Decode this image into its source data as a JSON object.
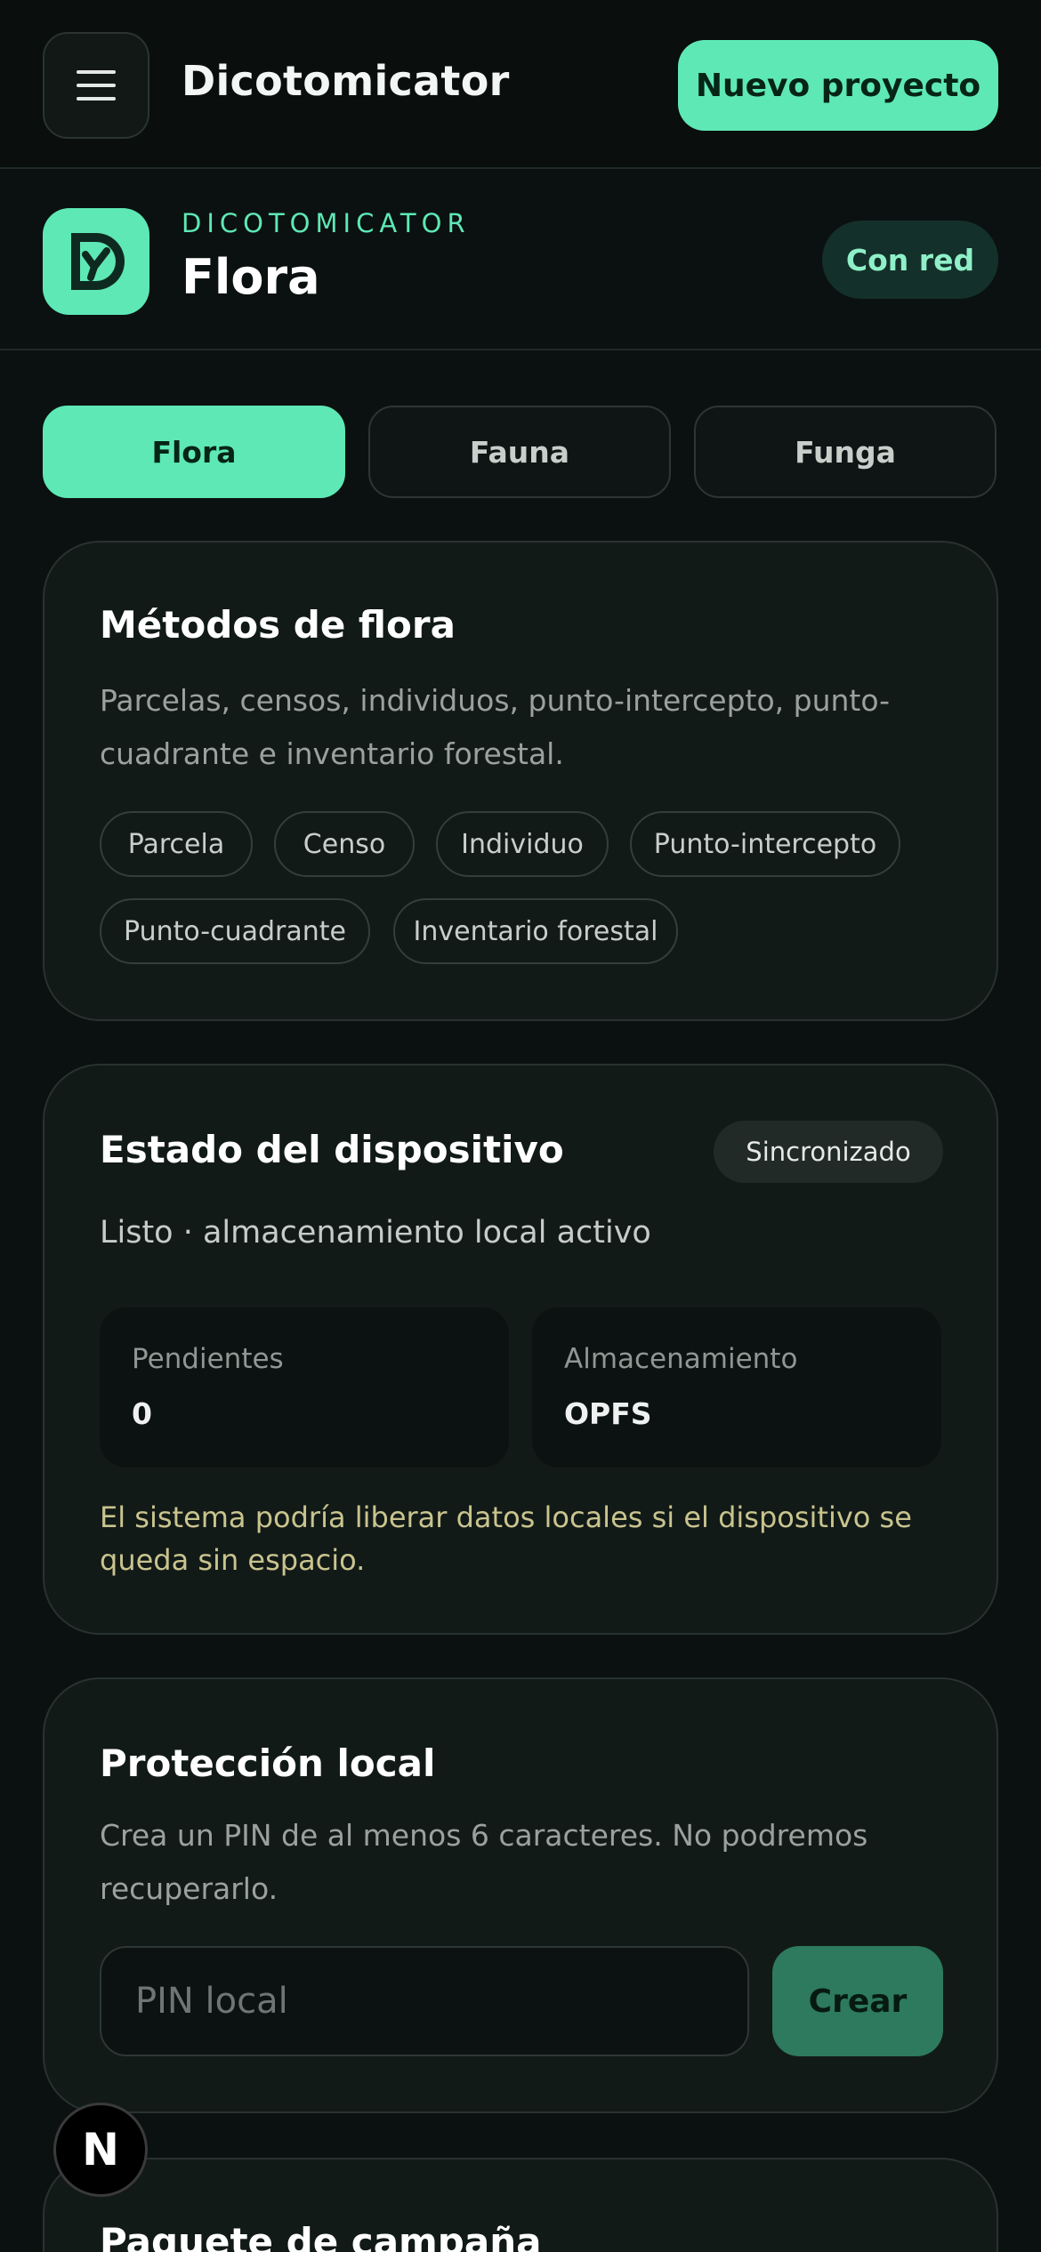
{
  "header": {
    "app_title": "Dicotomicator",
    "new_project_label": "Nuevo proyecto",
    "menu_icon": "hamburger-menu-icon"
  },
  "context": {
    "eyebrow": "DICOTOMICATOR",
    "title": "Flora",
    "network_status": "Con red",
    "logo_icon": "dicotomicator-logo-icon"
  },
  "tabs": [
    {
      "label": "Flora",
      "active": true
    },
    {
      "label": "Fauna",
      "active": false
    },
    {
      "label": "Funga",
      "active": false
    }
  ],
  "methods_card": {
    "title": "Métodos de flora",
    "description_line1": "Parcelas, censos, individuos, punto-intercepto, punto-",
    "description_line2": "cuadrante e inventario forestal.",
    "chips": [
      "Parcela",
      "Censo",
      "Individuo",
      "Punto-intercepto",
      "Punto-cuadrante",
      "Inventario forestal"
    ]
  },
  "device_card": {
    "title": "Estado del dispositivo",
    "sync_status": "Sincronizado",
    "status_line": "Listo · almacenamiento local activo",
    "pending_label": "Pendientes",
    "pending_value": "0",
    "storage_label": "Almacenamiento",
    "storage_value": "OPFS",
    "warning_line1": "El sistema podría liberar datos locales si el dispositivo se",
    "warning_line2": "queda sin espacio."
  },
  "protection_card": {
    "title": "Protección local",
    "description_line1": "Crea un PIN de al menos 6 caracteres. No podremos",
    "description_line2": "recuperarlo.",
    "pin_placeholder": "PIN local",
    "create_label": "Crear"
  },
  "package_card": {
    "title": "Paquete de campaña"
  },
  "dev_badge": {
    "letter": "N",
    "icon": "nextjs-logo-icon"
  },
  "colors": {
    "accent": "#5ee8b5",
    "background": "#0b1110",
    "card": "#121a18",
    "warning_text": "#c9c48e"
  }
}
